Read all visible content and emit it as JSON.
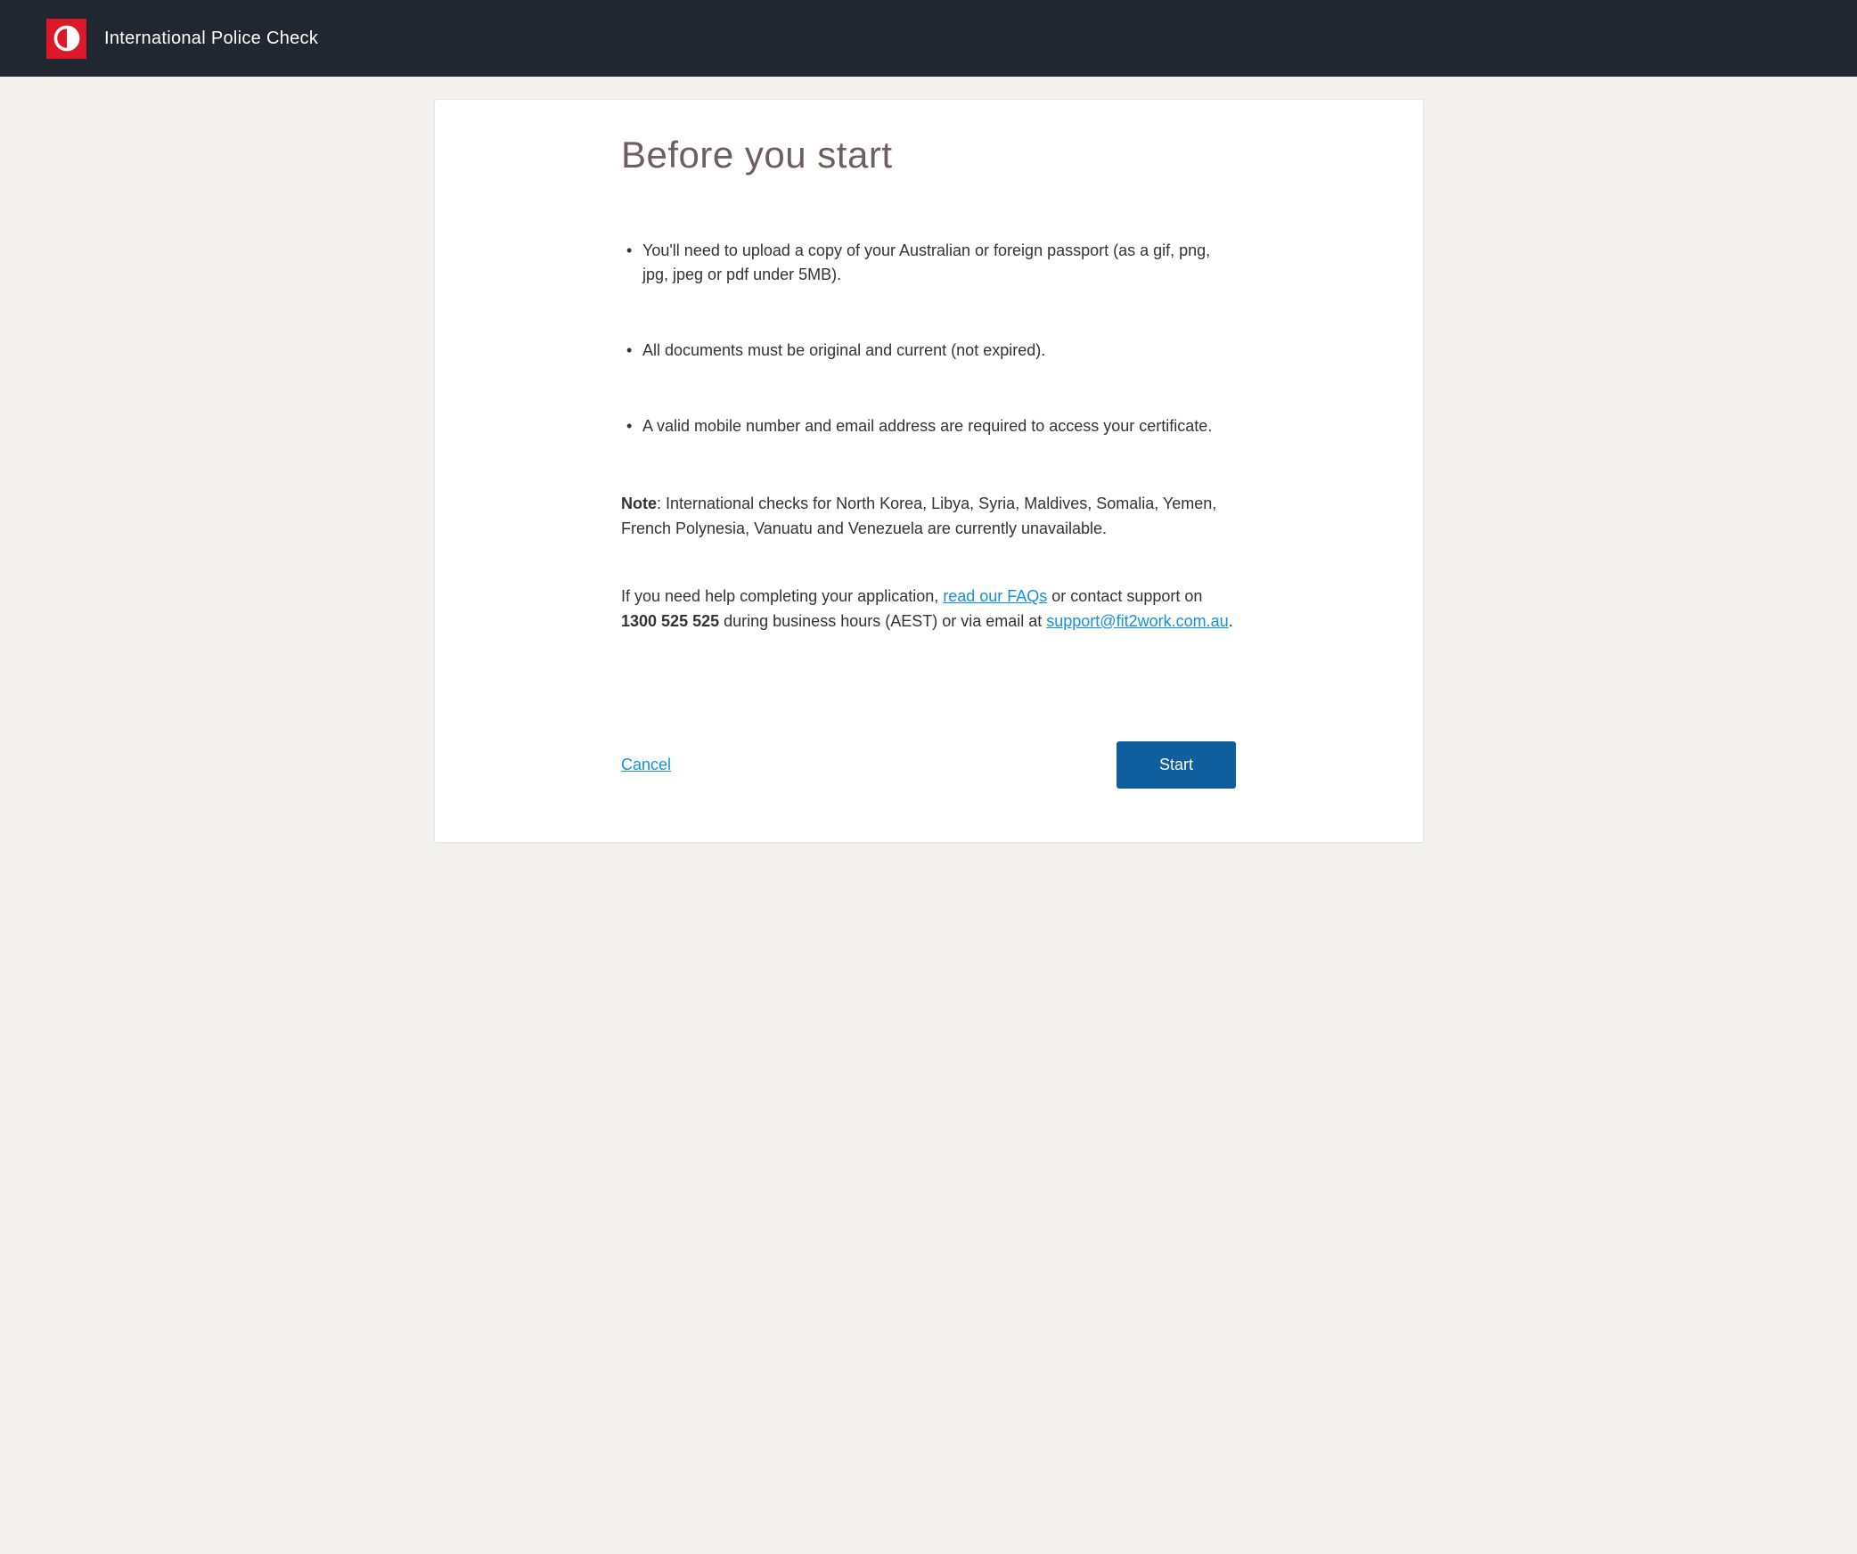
{
  "header": {
    "title": "International Police Check"
  },
  "main": {
    "title": "Before you start",
    "bullets": [
      "You'll need to upload a copy of your Australian or foreign passport (as a gif, png, jpg, jpeg or pdf under 5MB).",
      "All documents must be original and current (not expired).",
      "A valid mobile number and email address are required to access your certificate."
    ],
    "note": {
      "label": "Note",
      "text": ": International checks for North Korea, Libya, Syria, Maldives, Somalia, Yemen, French Polynesia, Vanuatu and Venezuela are currently unavailable."
    },
    "help": {
      "prefix": "If you need help completing your application, ",
      "faq_link": "read our FAQs",
      "mid1": " or contact support on ",
      "phone": "1300 525 525",
      "mid2": " during business hours (AEST) or via email at ",
      "email_link": "support@fit2work.com.au",
      "suffix": "."
    },
    "actions": {
      "cancel": "Cancel",
      "start": "Start"
    }
  }
}
